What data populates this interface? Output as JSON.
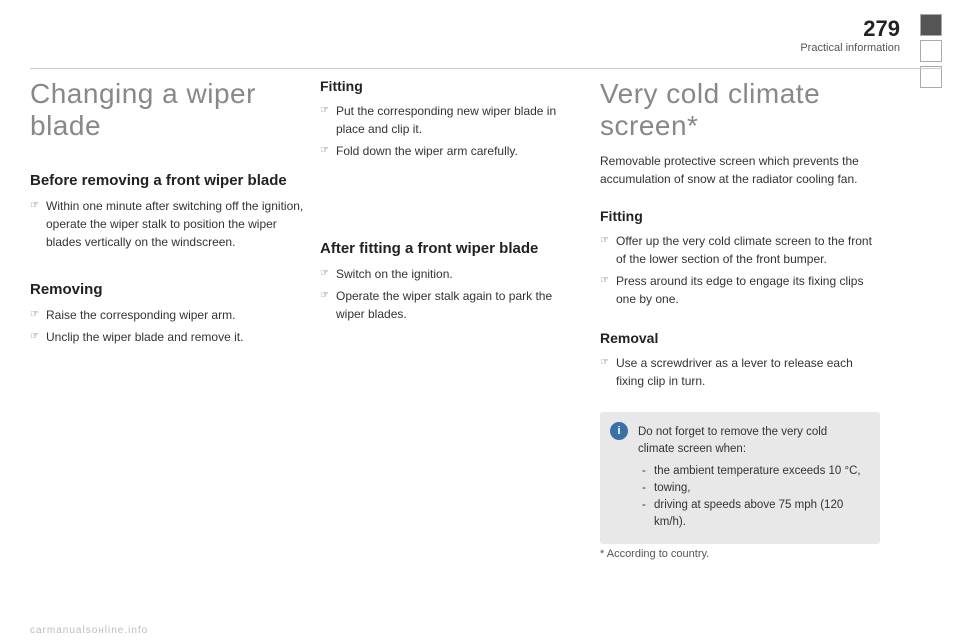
{
  "page": {
    "number": "279",
    "section": "Practical information"
  },
  "nav_boxes": [
    {
      "active": true
    },
    {
      "active": false
    },
    {
      "active": false
    }
  ],
  "left_column": {
    "title": "Changing a wiper blade",
    "before_heading": "Before removing a front wiper blade",
    "before_bullets": [
      "Within one minute after switching off the ignition, operate the wiper stalk to position the wiper blades vertically on the windscreen."
    ],
    "removing_heading": "Removing",
    "removing_bullets": [
      "Raise the corresponding wiper arm.",
      "Unclip the wiper blade and remove it."
    ]
  },
  "middle_column": {
    "fitting_heading": "Fitting",
    "fitting_bullets": [
      "Put the corresponding new wiper blade in place and clip it.",
      "Fold down the wiper arm carefully."
    ],
    "after_fitting_heading": "After fitting a front wiper blade",
    "after_fitting_bullets": [
      "Switch on the ignition.",
      "Operate the wiper stalk again to park the wiper blades."
    ]
  },
  "right_column": {
    "title": "Very cold climate screen*",
    "subtitle": "Removable protective screen which prevents the accumulation of snow at the radiator cooling fan.",
    "fitting_heading": "Fitting",
    "fitting_bullets": [
      "Offer up the very cold climate screen to the front of the lower section of the front bumper.",
      "Press around its edge to engage its fixing clips one by one."
    ],
    "removal_heading": "Removal",
    "removal_bullets": [
      "Use a screwdriver as a lever to release each fixing clip in turn."
    ],
    "info_box_text": "Do not forget to remove the very cold climate screen when:",
    "info_box_list": [
      "the ambient temperature exceeds 10 °C,",
      "towing,",
      "driving at speeds above 75 mph (120 km/h)."
    ],
    "footnote": "* According to country."
  },
  "watermark": "carmanualsонline.info"
}
